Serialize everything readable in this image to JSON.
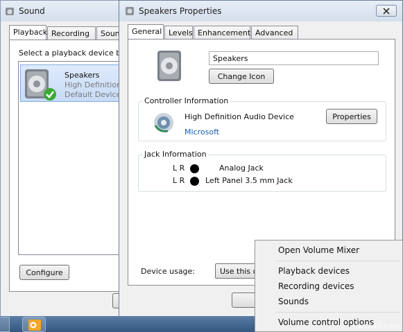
{
  "sound_window": {
    "title": "Sound",
    "tabs": [
      "Playback",
      "Recording",
      "Sounds"
    ],
    "instruction": "Select a playback device belo",
    "device": {
      "name": "Speakers",
      "line2": "High Definition",
      "line3": "Default Device"
    },
    "configure_label": "Configure"
  },
  "props_window": {
    "title": "Speakers Properties",
    "tabs": [
      "General",
      "Levels",
      "Enhancements",
      "Advanced"
    ],
    "name_value": "Speakers",
    "change_icon_label": "Change Icon",
    "controller": {
      "label": "Controller Information",
      "device": "High Definition Audio Device",
      "vendor": "Microsoft",
      "properties_label": "Properties"
    },
    "jack": {
      "label": "Jack Information",
      "rows": [
        {
          "lr": "L R",
          "name": "Analog Jack"
        },
        {
          "lr": "L R",
          "name": "Left Panel 3.5 mm Jack"
        }
      ]
    },
    "device_usage_label": "Device usage:",
    "usage_value": "Use this d"
  },
  "context_menu": {
    "items": [
      "Open Volume Mixer",
      "Playback devices",
      "Recording devices",
      "Sounds",
      "Volume control options"
    ]
  },
  "watermark": "wsxdn.com",
  "colors": {
    "link": "#1a5fb4",
    "accent_check": "#3aaa35"
  }
}
